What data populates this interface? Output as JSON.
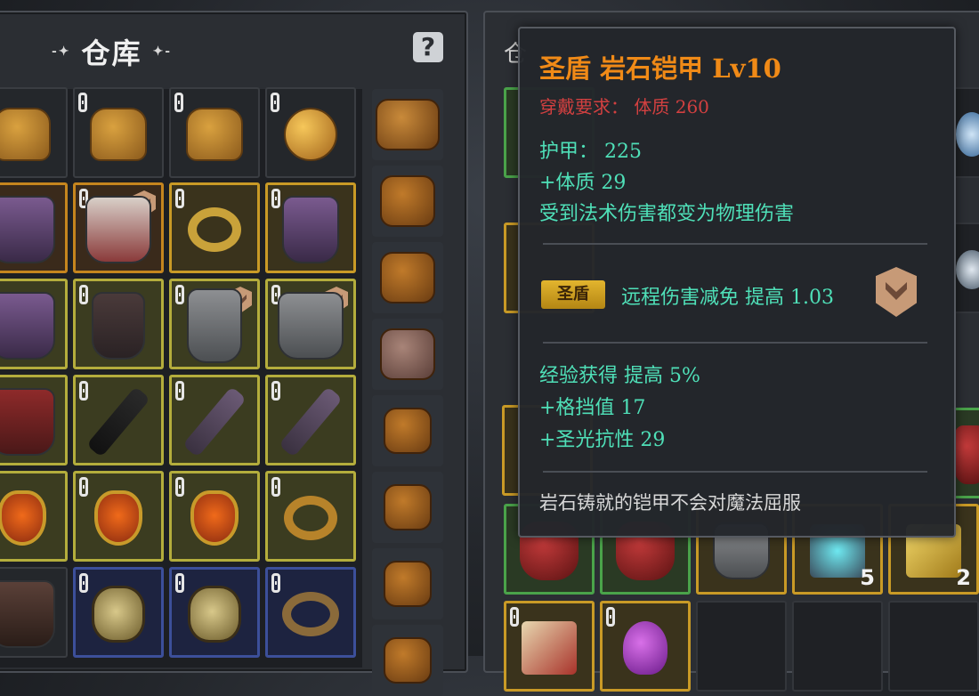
{
  "warehouse": {
    "title": "仓库",
    "title_deco_left": "-✦",
    "title_deco_right": "✦-",
    "help_icon": "?"
  },
  "right_panel": {
    "partial_title": "仓"
  },
  "tooltip": {
    "title": "圣盾  岩石铠甲  Lv10",
    "requirement": "穿戴要求：  体质  260",
    "armor": "护甲：  225",
    "constitution": "+体质  29",
    "special": "受到法术伤害都变为物理伤害",
    "set_badge": "圣盾",
    "set_bonus": "远程伤害减免  提高  1.03",
    "exp": "经验获得  提高  5%",
    "block": "+格挡值  17",
    "holy_resist": "+圣光抗性  29",
    "flavor": "岩石铸就的铠甲不会对魔法屈服"
  },
  "stack_counts": {
    "scroll_blue": "5",
    "scroll_gold": "2"
  },
  "colors": {
    "title_orange": "#f08a17",
    "requirement_red": "#d24040",
    "stat_green": "#4fe0b8",
    "set_badge_gold": "#e3b52e"
  }
}
